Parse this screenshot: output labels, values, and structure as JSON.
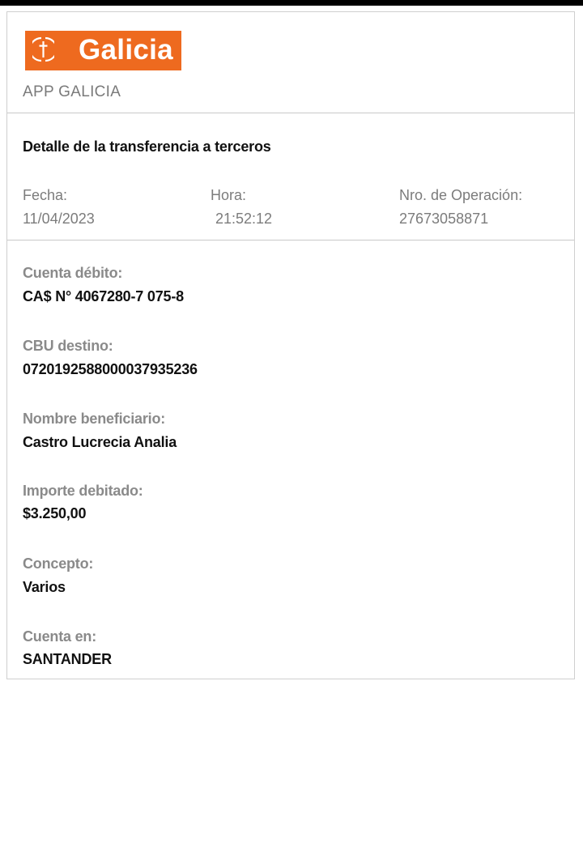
{
  "brand": {
    "logo_text": "Galicia",
    "logo_color": "#ee6a1f",
    "app_name": "APP GALICIA"
  },
  "transfer": {
    "title": "Detalle de la transferencia a terceros",
    "date_label": "Fecha:",
    "date_value": "11/04/2023",
    "time_label": "Hora:",
    "time_value": "21:52:12",
    "operation_label": "Nro. de Operación:",
    "operation_value": "27673058871"
  },
  "fields": [
    {
      "label": "Cuenta débito:",
      "value": "CA$ N° 4067280-7 075-8"
    },
    {
      "label": "CBU destino:",
      "value": "0720192588000037935236"
    },
    {
      "label": "Nombre beneficiario:",
      "value": "Castro Lucrecia Analia"
    },
    {
      "label": "Importe debitado:",
      "value": "$3.250,00"
    },
    {
      "label": "Concepto:",
      "value": "Varios"
    },
    {
      "label": "Cuenta en:",
      "value": "SANTANDER"
    }
  ]
}
